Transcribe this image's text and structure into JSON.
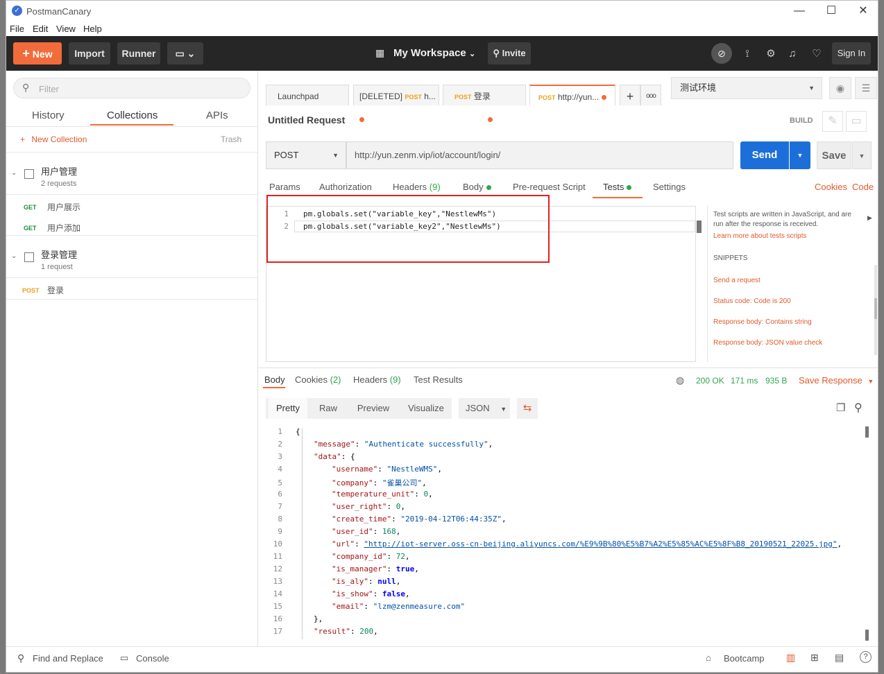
{
  "window": {
    "title": "PostmanCanary",
    "logo_glyph": "✓",
    "minimize": "—",
    "maximize": "☐",
    "close": "✕"
  },
  "menu": [
    "File",
    "Edit",
    "View",
    "Help"
  ],
  "toolbar": {
    "new_label": "New",
    "import_label": "Import",
    "runner_label": "Runner",
    "workspace": "My Workspace",
    "invite_label": "Invite",
    "signin_label": "Sign In",
    "accent": "#f26b3a"
  },
  "sidebar": {
    "filter_placeholder": "Filter",
    "tabs": [
      "History",
      "Collections",
      "APIs"
    ],
    "new_collection": "New Collection",
    "trash": "Trash",
    "collections": [
      {
        "name": "用户管理",
        "count": "2 requests",
        "requests": [
          {
            "method": "GET",
            "name": "用户展示"
          },
          {
            "method": "GET",
            "name": "用户添加"
          }
        ]
      },
      {
        "name": "登录管理",
        "count": "1 request",
        "requests": [
          {
            "method": "POST",
            "name": "登录"
          }
        ]
      }
    ]
  },
  "tabs": {
    "items": [
      {
        "label": "Launchpad"
      },
      {
        "prefix": "[DELETED]",
        "method": "POST",
        "label": "h..."
      },
      {
        "method": "POST",
        "label": "登录"
      },
      {
        "method": "POST",
        "label": "http://yun..."
      }
    ],
    "add": "+",
    "more": "ooo"
  },
  "environment": {
    "selected": "测试环境"
  },
  "request": {
    "name": "Untitled Request",
    "build": "BUILD",
    "method": "POST",
    "url": "http://yun.zenm.vip/iot/account/login/",
    "send": "Send",
    "save": "Save"
  },
  "params_tabs": [
    {
      "label": "Params"
    },
    {
      "label": "Authorization"
    },
    {
      "label": "Headers",
      "count": "(9)"
    },
    {
      "label": "Body"
    },
    {
      "label": "Pre-request Script"
    },
    {
      "label": "Tests"
    },
    {
      "label": "Settings"
    }
  ],
  "links": {
    "cookies": "Cookies",
    "code": "Code"
  },
  "tests_code": [
    {
      "n": "1",
      "text": "pm.globals.set(\"variable_key\",\"NestlewMs\")"
    },
    {
      "n": "2",
      "text": "pm.globals.set(\"variable_key2\",\"NestlewMs\")"
    }
  ],
  "snippets_panel": {
    "desc": "Test scripts are written in JavaScript, and are run after the response is received.",
    "learn_more": "Learn more about tests scripts",
    "heading": "SNIPPETS",
    "items": [
      "Send a request",
      "Status code: Code is 200",
      "Response body: Contains string",
      "Response body: JSON value check"
    ]
  },
  "response": {
    "tabs": [
      {
        "label": "Body"
      },
      {
        "label": "Cookies",
        "count": "(2)"
      },
      {
        "label": "Headers",
        "count": "(9)"
      },
      {
        "label": "Test Results"
      }
    ],
    "status": "200 OK",
    "time": "171 ms",
    "size": "935 B",
    "save_response": "Save Response",
    "views": [
      "Pretty",
      "Raw",
      "Preview",
      "Visualize"
    ],
    "format": "JSON",
    "lines": [
      {
        "n": "1",
        "indent": 0,
        "parts": [
          {
            "t": "{",
            "c": ""
          }
        ]
      },
      {
        "n": "2",
        "indent": 1,
        "parts": [
          {
            "t": "\"message\"",
            "c": "key"
          },
          {
            "t": ": ",
            "c": ""
          },
          {
            "t": "\"Authenticate successfully\"",
            "c": "str"
          },
          {
            "t": ",",
            "c": ""
          }
        ]
      },
      {
        "n": "3",
        "indent": 1,
        "parts": [
          {
            "t": "\"data\"",
            "c": "key"
          },
          {
            "t": ": {",
            "c": ""
          }
        ]
      },
      {
        "n": "4",
        "indent": 2,
        "parts": [
          {
            "t": "\"username\"",
            "c": "key"
          },
          {
            "t": ": ",
            "c": ""
          },
          {
            "t": "\"NestleWMS\"",
            "c": "str"
          },
          {
            "t": ",",
            "c": ""
          }
        ]
      },
      {
        "n": "5",
        "indent": 2,
        "parts": [
          {
            "t": "\"company\"",
            "c": "key"
          },
          {
            "t": ": ",
            "c": ""
          },
          {
            "t": "\"雀巢公司\"",
            "c": "str"
          },
          {
            "t": ",",
            "c": ""
          }
        ]
      },
      {
        "n": "6",
        "indent": 2,
        "parts": [
          {
            "t": "\"temperature_unit\"",
            "c": "key"
          },
          {
            "t": ": ",
            "c": ""
          },
          {
            "t": "0",
            "c": "num"
          },
          {
            "t": ",",
            "c": ""
          }
        ]
      },
      {
        "n": "7",
        "indent": 2,
        "parts": [
          {
            "t": "\"user_right\"",
            "c": "key"
          },
          {
            "t": ": ",
            "c": ""
          },
          {
            "t": "0",
            "c": "num"
          },
          {
            "t": ",",
            "c": ""
          }
        ]
      },
      {
        "n": "8",
        "indent": 2,
        "parts": [
          {
            "t": "\"create_time\"",
            "c": "key"
          },
          {
            "t": ": ",
            "c": ""
          },
          {
            "t": "\"2019-04-12T06:44:35Z\"",
            "c": "str"
          },
          {
            "t": ",",
            "c": ""
          }
        ]
      },
      {
        "n": "9",
        "indent": 2,
        "parts": [
          {
            "t": "\"user_id\"",
            "c": "key"
          },
          {
            "t": ": ",
            "c": ""
          },
          {
            "t": "168",
            "c": "num"
          },
          {
            "t": ",",
            "c": ""
          }
        ]
      },
      {
        "n": "10",
        "indent": 2,
        "parts": [
          {
            "t": "\"url\"",
            "c": "key"
          },
          {
            "t": ": ",
            "c": ""
          },
          {
            "t": "\"http://iot-server.oss-cn-beijing.aliyuncs.com/%E9%9B%80%E5%B7%A2%E5%85%AC%E5%8F%B8_20190521_22025.jpg\"",
            "c": "str"
          },
          {
            "t": ",",
            "c": ""
          }
        ]
      },
      {
        "n": "11",
        "indent": 2,
        "parts": [
          {
            "t": "\"company_id\"",
            "c": "key"
          },
          {
            "t": ": ",
            "c": ""
          },
          {
            "t": "72",
            "c": "num"
          },
          {
            "t": ",",
            "c": ""
          }
        ]
      },
      {
        "n": "12",
        "indent": 2,
        "parts": [
          {
            "t": "\"is_manager\"",
            "c": "key"
          },
          {
            "t": ": ",
            "c": ""
          },
          {
            "t": "true",
            "c": "kw"
          },
          {
            "t": ",",
            "c": ""
          }
        ]
      },
      {
        "n": "13",
        "indent": 2,
        "parts": [
          {
            "t": "\"is_aly\"",
            "c": "key"
          },
          {
            "t": ": ",
            "c": ""
          },
          {
            "t": "null",
            "c": "kw"
          },
          {
            "t": ",",
            "c": ""
          }
        ]
      },
      {
        "n": "14",
        "indent": 2,
        "parts": [
          {
            "t": "\"is_show\"",
            "c": "key"
          },
          {
            "t": ": ",
            "c": ""
          },
          {
            "t": "false",
            "c": "kw"
          },
          {
            "t": ",",
            "c": ""
          }
        ]
      },
      {
        "n": "15",
        "indent": 2,
        "parts": [
          {
            "t": "\"email\"",
            "c": "key"
          },
          {
            "t": ": ",
            "c": ""
          },
          {
            "t": "\"lzm@zenmeasure.com\"",
            "c": "str"
          }
        ]
      },
      {
        "n": "16",
        "indent": 1,
        "parts": [
          {
            "t": "},",
            "c": ""
          }
        ]
      },
      {
        "n": "17",
        "indent": 1,
        "parts": [
          {
            "t": "\"result\"",
            "c": "key"
          },
          {
            "t": ": ",
            "c": ""
          },
          {
            "t": "200",
            "c": "num"
          },
          {
            "t": ",",
            "c": ""
          }
        ]
      }
    ]
  },
  "statusbar": {
    "find_replace": "Find and Replace",
    "console": "Console",
    "bootcamp": "Bootcamp"
  }
}
